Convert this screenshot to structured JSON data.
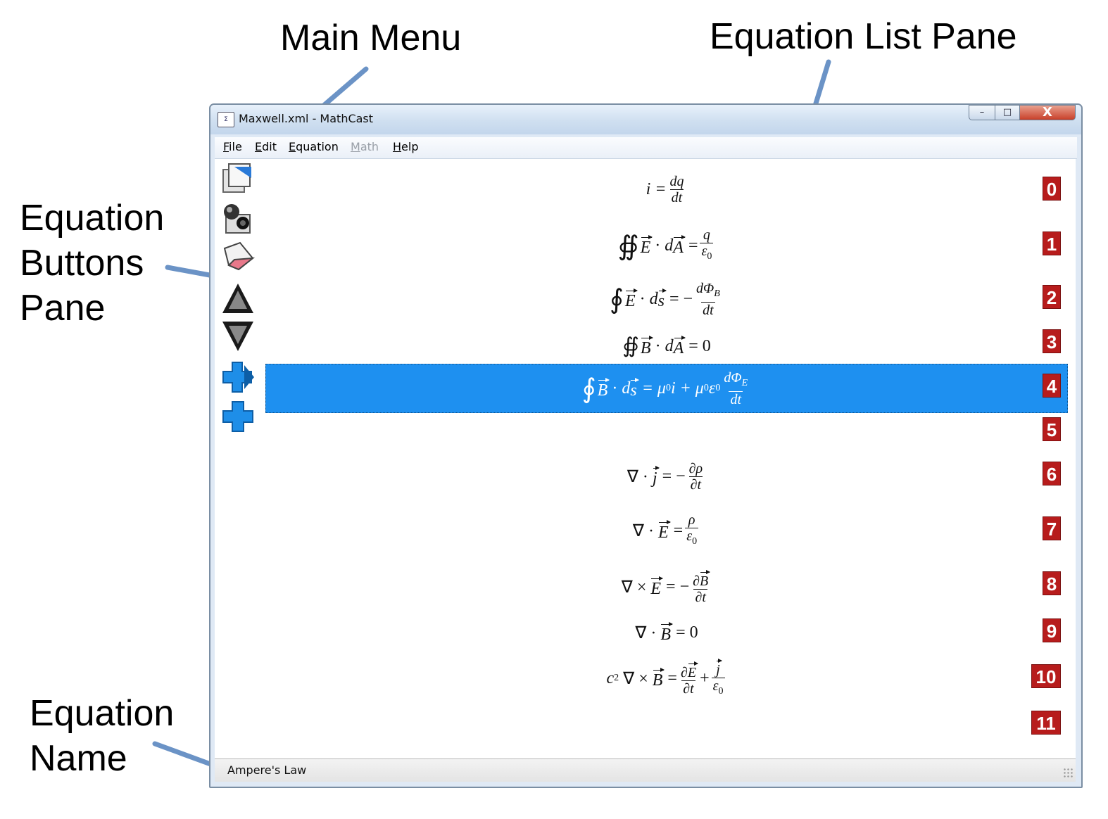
{
  "callouts": {
    "main_menu": "Main Menu",
    "equation_list_pane": "Equation List Pane",
    "equation_buttons_pane": [
      "Equation",
      "Buttons",
      "Pane"
    ],
    "equation_name": [
      "Equation",
      "Name"
    ]
  },
  "window": {
    "title": "Maxwell.xml - MathCast",
    "controls": {
      "minimize": "–",
      "maximize": "□",
      "close": "X"
    }
  },
  "menu": [
    "File",
    "Edit",
    "Equation",
    "Math",
    "Help"
  ],
  "menu_disabled": [
    "Math"
  ],
  "toolbar": [
    "new-equation-icon",
    "edit-equation-icon",
    "eraser-icon",
    "move-up-icon",
    "move-down-icon",
    "insert-equation-icon",
    "add-equation-icon"
  ],
  "equations": {
    "selected_index": 4,
    "indices": [
      "0",
      "1",
      "2",
      "3",
      "4",
      "5",
      "6",
      "7",
      "8",
      "9",
      "10",
      "11"
    ],
    "e0": {
      "lhs": "i =",
      "num": "dq",
      "den": "dt"
    },
    "e1": {
      "int": "∯",
      "E": "E",
      "dot": "·",
      "d": "d",
      "A": "A",
      "eq": "=",
      "num": "q",
      "den": "ε",
      "den_sub": "0"
    },
    "e2": {
      "int": "∮",
      "E": "E",
      "dot": "·",
      "d": "d",
      "s": "s",
      "eq": "= −",
      "num": "dΦ",
      "num_sub": "B",
      "den": "dt"
    },
    "e3": {
      "int": "∯",
      "B": "B",
      "dot": "·",
      "d": "d",
      "A": "A",
      "rhs": "= 0"
    },
    "e4": {
      "int": "∮",
      "B": "B",
      "dot": "·",
      "d": "d",
      "s": "s",
      "eq": "= μ",
      "sub1": "0",
      "i_plus": "i + μ",
      "sub2": "0",
      "eps": "ε",
      "sub3": "0",
      "num": "dΦ",
      "num_sub": "E",
      "den": "dt"
    },
    "e6": {
      "nabla": "∇ ·",
      "j": "j",
      "eq": "= −",
      "num": "∂ρ",
      "den": "∂t"
    },
    "e7": {
      "nabla": "∇ ·",
      "E": "E",
      "eq": "=",
      "num": "ρ",
      "den": "ε",
      "den_sub": "0"
    },
    "e8": {
      "nabla": "∇ ×",
      "E": "E",
      "eq": "= −",
      "num": "∂",
      "num_vec": "B",
      "den": "∂t"
    },
    "e9": {
      "nabla": "∇ ·",
      "B": "B",
      "rhs": "= 0"
    },
    "e10": {
      "c": "c",
      "sup": "2",
      "nabla": "∇ ×",
      "B": "B",
      "eq": "=",
      "num1": "∂",
      "num1_vec": "E",
      "den1": "∂t",
      "plus": "+",
      "num2_vec": "j",
      "den2": "ε",
      "den2_sub": "0"
    }
  },
  "status": {
    "equation_name": "Ampere's Law"
  },
  "colors": {
    "selection": "#1e90f0",
    "index_badge": "#b71c1c",
    "callout_line": "#6b93c6"
  }
}
